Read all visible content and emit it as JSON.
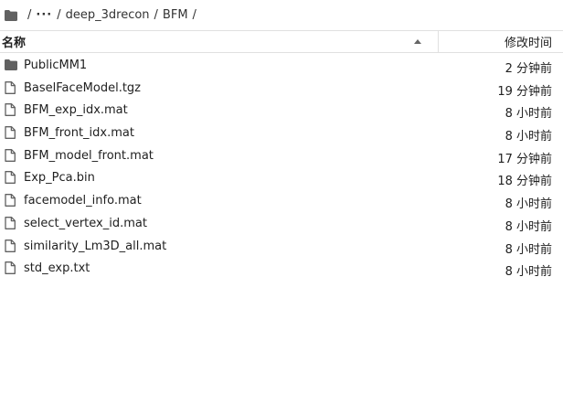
{
  "breadcrumb": {
    "root_icon": "folder-icon",
    "sep1": "/",
    "ellipsis": "···",
    "sep2": "/",
    "item1": "deep_3drecon",
    "sep3": "/",
    "item2": "BFM",
    "sep4": "/"
  },
  "header": {
    "name_label": "名称",
    "time_label": "修改时间",
    "sort_direction": "ascending"
  },
  "files": [
    {
      "name": "PublicMM1",
      "time": "2 分钟前",
      "icon": "folder-icon"
    },
    {
      "name": "BaselFaceModel.tgz",
      "time": "19 分钟前",
      "icon": "file-icon"
    },
    {
      "name": "BFM_exp_idx.mat",
      "time": "8 小时前",
      "icon": "file-icon"
    },
    {
      "name": "BFM_front_idx.mat",
      "time": "8 小时前",
      "icon": "file-icon"
    },
    {
      "name": "BFM_model_front.mat",
      "time": "17 分钟前",
      "icon": "file-icon"
    },
    {
      "name": "Exp_Pca.bin",
      "time": "18 分钟前",
      "icon": "file-icon"
    },
    {
      "name": "facemodel_info.mat",
      "time": "8 小时前",
      "icon": "file-icon"
    },
    {
      "name": "select_vertex_id.mat",
      "time": "8 小时前",
      "icon": "file-icon"
    },
    {
      "name": "similarity_Lm3D_all.mat",
      "time": "8 小时前",
      "icon": "file-icon"
    },
    {
      "name": "std_exp.txt",
      "time": "8 小时前",
      "icon": "file-icon"
    }
  ],
  "colors": {
    "icon": "#616161",
    "border": "#e0e0e0",
    "text": "#212121"
  }
}
